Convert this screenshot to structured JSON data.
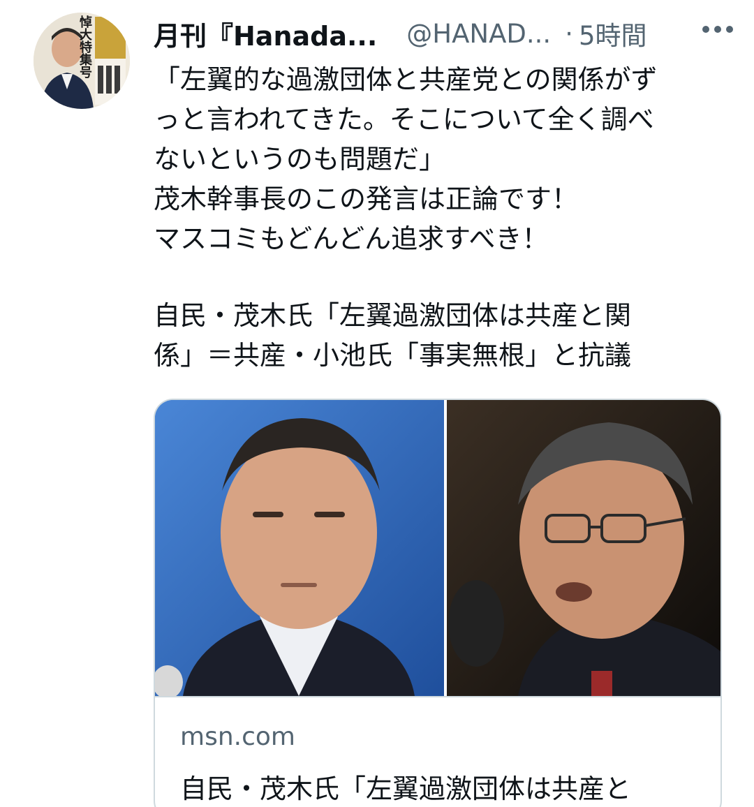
{
  "tweet": {
    "display_name": "月刊『Hanada...",
    "handle": "@HANAD...",
    "separator": "·",
    "timestamp": "5時間",
    "body_lines": [
      "「左翼的な過激団体と共産党との関係がず",
      "っと言われてきた。そこについて全く調べ",
      "ないというのも問題だ」",
      "茂木幹事長のこの発言は正論です！",
      "マスコミもどんどん追求すべき！"
    ],
    "headline_lines": [
      "自民・茂木氏「左翼過激団体は共産と関",
      "係」＝共産・小池氏「事実無根」と抗議"
    ],
    "avatar_text": "悼大特集号"
  },
  "card": {
    "domain": "msn.com",
    "title": "自民・茂木氏「左翼過激団体は共産と"
  },
  "icons": {
    "more": "more-horizontal-icon"
  },
  "colors": {
    "text": "#0f1419",
    "secondary": "#536471",
    "border": "#cfd9de"
  }
}
